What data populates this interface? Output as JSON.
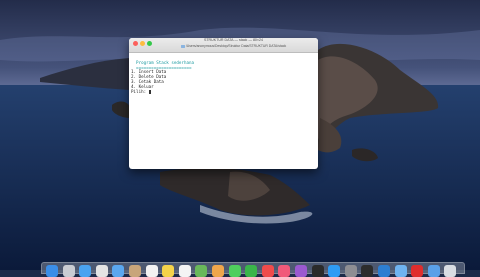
{
  "window": {
    "title": "STRUKTUR DATA — stack — 80×24",
    "path": "/Users/anonymous/Desktop/Struktur Data/STRUKTUR DATA/stack",
    "lines": [
      "",
      "  Program Stack sederhana",
      "  ======================",
      "1. Insert Data",
      "2. Delete Data",
      "3. Cetak Data",
      "4. Keluar",
      "Pilih: "
    ]
  },
  "dock": {
    "apps": [
      {
        "icon": "finder-icon",
        "color": "#3b8ee8"
      },
      {
        "icon": "launchpad-icon",
        "color": "#c9ccd3"
      },
      {
        "icon": "safari-icon",
        "color": "#4aa3f0"
      },
      {
        "icon": "chrome-icon",
        "color": "#e4e4e4"
      },
      {
        "icon": "mail-icon",
        "color": "#5aa7ef"
      },
      {
        "icon": "contacts-icon",
        "color": "#c8a57a"
      },
      {
        "icon": "calendar-icon",
        "color": "#f2f2f2"
      },
      {
        "icon": "notes-icon",
        "color": "#f5d34a"
      },
      {
        "icon": "reminders-icon",
        "color": "#f4f4f4"
      },
      {
        "icon": "maps-icon",
        "color": "#69b85a"
      },
      {
        "icon": "photos-icon",
        "color": "#f0a64b"
      },
      {
        "icon": "messages-icon",
        "color": "#4fce5d"
      },
      {
        "icon": "facetime-icon",
        "color": "#3ab54a"
      },
      {
        "icon": "news-icon",
        "color": "#f04b4b"
      },
      {
        "icon": "music-icon",
        "color": "#f15a7a"
      },
      {
        "icon": "podcasts-icon",
        "color": "#9b59d0"
      },
      {
        "icon": "tv-icon",
        "color": "#2b2b2b"
      },
      {
        "icon": "appstore-icon",
        "color": "#2f9cf4"
      },
      {
        "icon": "preferences-icon",
        "color": "#8e8e93"
      },
      {
        "icon": "terminal-icon",
        "color": "#2d2d2d"
      },
      {
        "icon": "vscode-icon",
        "color": "#2d7ed1"
      },
      {
        "icon": "folder-icon",
        "color": "#6fb3f0"
      },
      {
        "icon": "acrobat-icon",
        "color": "#e02d2d"
      },
      {
        "icon": "downloads-icon",
        "color": "#5aa0e8"
      },
      {
        "icon": "trash-icon",
        "color": "#d9dde3"
      }
    ]
  }
}
